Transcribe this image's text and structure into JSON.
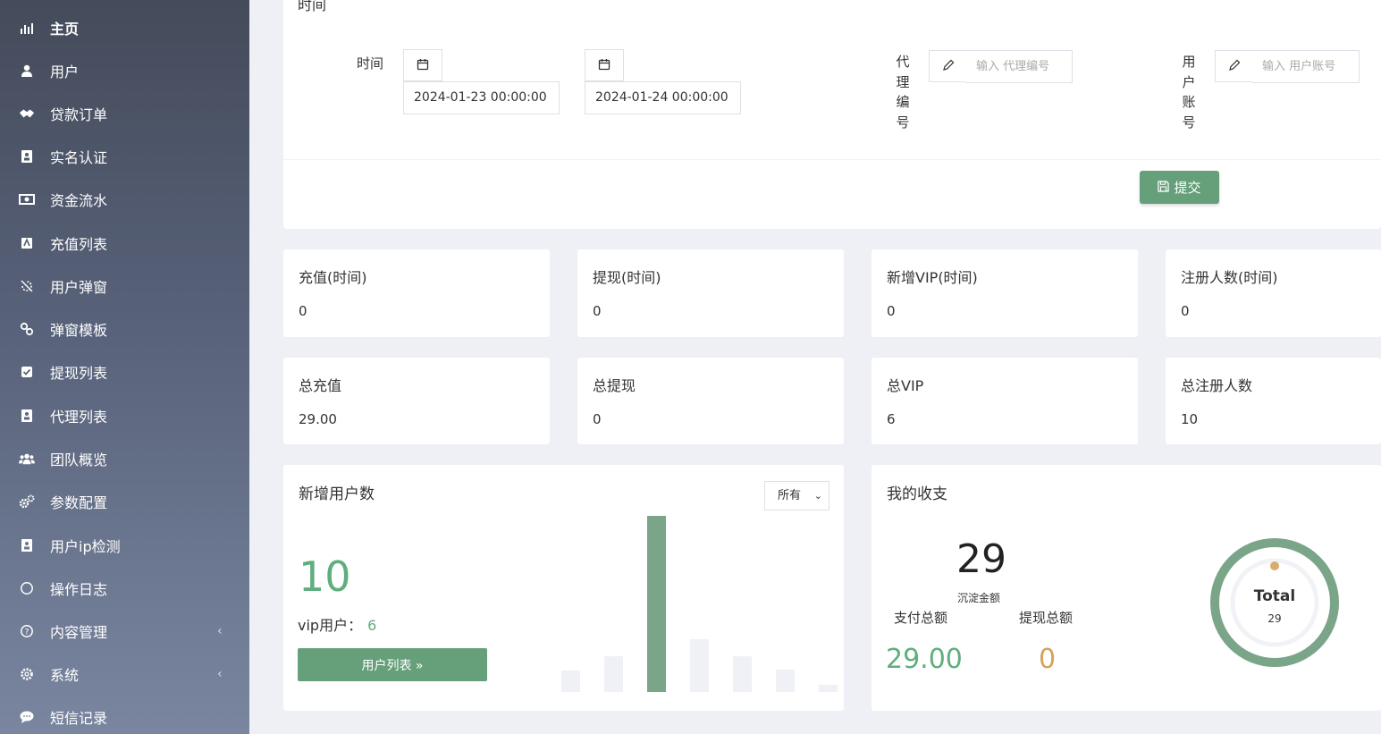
{
  "sidebar": {
    "items": [
      {
        "label": "主页",
        "icon": "bar-chart-icon"
      },
      {
        "label": "用户",
        "icon": "user-icon"
      },
      {
        "label": "贷款订单",
        "icon": "handshake-icon"
      },
      {
        "label": "实名认证",
        "icon": "id-card-icon"
      },
      {
        "label": "资金流水",
        "icon": "money-icon"
      },
      {
        "label": "充值列表",
        "icon": "list-icon"
      },
      {
        "label": "用户弹窗",
        "icon": "popup-icon"
      },
      {
        "label": "弹窗模板",
        "icon": "link-icon"
      },
      {
        "label": "提现列表",
        "icon": "check-square-icon"
      },
      {
        "label": "代理列表",
        "icon": "contact-book-icon"
      },
      {
        "label": "团队概览",
        "icon": "users-icon"
      },
      {
        "label": "参数配置",
        "icon": "cogs-icon"
      },
      {
        "label": "用户ip检测",
        "icon": "address-book-icon"
      },
      {
        "label": "操作日志",
        "icon": "circle-icon"
      },
      {
        "label": "内容管理",
        "icon": "question-circle-icon",
        "chevron": "‹"
      },
      {
        "label": "系统",
        "icon": "gear-icon",
        "chevron": "‹"
      },
      {
        "label": "短信记录",
        "icon": "chat-bubble-icon"
      }
    ]
  },
  "filter": {
    "cut_title": "时间",
    "time_label": "时间",
    "start_date": "2024-01-23 00:00:00",
    "end_date": "2024-01-24 00:00:00",
    "agent_label": [
      "代",
      "理",
      "编",
      "号"
    ],
    "agent_placeholder": "输入 代理编号",
    "user_label": [
      "用",
      "户",
      "账",
      "号"
    ],
    "user_placeholder": "输入 用户账号",
    "submit_label": "提交"
  },
  "stats_period": [
    {
      "title": "充值(时间)",
      "value": "0"
    },
    {
      "title": "提现(时间)",
      "value": "0"
    },
    {
      "title": "新增VIP(时间)",
      "value": "0"
    },
    {
      "title": "注册人数(时间)",
      "value": "0"
    }
  ],
  "stats_total": [
    {
      "title": "总充值",
      "value": "29.00"
    },
    {
      "title": "总提现",
      "value": "0"
    },
    {
      "title": "总VIP",
      "value": "6"
    },
    {
      "title": "总注册人数",
      "value": "10"
    }
  ],
  "new_users": {
    "title": "新增用户数",
    "select_value": "所有",
    "count": "10",
    "vip_label": "vip用户：",
    "vip_value": "6",
    "button_label": "用户列表 »"
  },
  "chart_data": {
    "type": "bar",
    "categories": [
      "",
      "",
      "",
      "",
      "",
      "",
      ""
    ],
    "values": [
      2.4,
      4,
      19.5,
      5.8,
      4,
      2.5,
      0.8
    ],
    "highlight_index": 2,
    "colors": {
      "highlight": "#7aa589",
      "normal": "#f0f1f6"
    }
  },
  "finance": {
    "title": "我的收支",
    "balance": "29",
    "balance_label": "沉淀金额",
    "pay_label": "支付总额",
    "pay_value": "29.00",
    "withdraw_label": "提现总额",
    "withdraw_value": "0",
    "donut_label": "Total",
    "donut_value": "29",
    "donut_fraction": 1.0
  },
  "colors": {
    "accent": "#65a07a",
    "green_text": "#5fae7d",
    "orange_text": "#d4a35b"
  }
}
